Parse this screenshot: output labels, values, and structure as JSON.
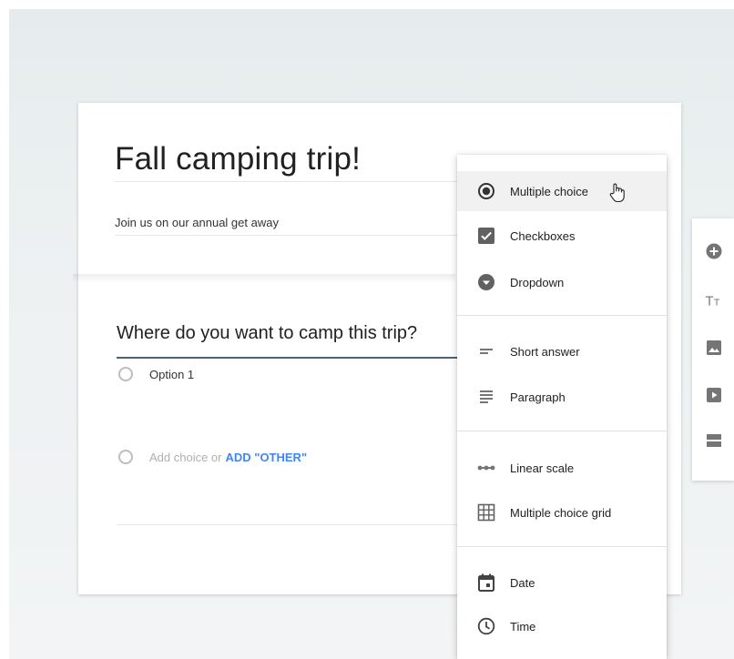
{
  "form": {
    "title": "Fall camping trip!",
    "description": "Join us on our annual get away",
    "question": "Where do you want to camp this trip?",
    "option1": "Option 1",
    "add_choice": "Add choice or",
    "add_other": "ADD \"OTHER\""
  },
  "menu": {
    "items": [
      {
        "label": "Multiple choice",
        "icon": "radio-button-icon"
      },
      {
        "label": "Checkboxes",
        "icon": "checkbox-icon"
      },
      {
        "label": "Dropdown",
        "icon": "dropdown-icon"
      },
      {
        "label": "Short answer",
        "icon": "short-answer-icon"
      },
      {
        "label": "Paragraph",
        "icon": "paragraph-icon"
      },
      {
        "label": "Linear scale",
        "icon": "linear-scale-icon"
      },
      {
        "label": "Multiple choice grid",
        "icon": "grid-icon"
      },
      {
        "label": "Date",
        "icon": "calendar-icon"
      },
      {
        "label": "Time",
        "icon": "clock-icon"
      }
    ],
    "selected": "Multiple choice"
  },
  "toolbar": {
    "tools": [
      "add-question-icon",
      "title-text-icon",
      "image-icon",
      "video-icon",
      "section-icon"
    ]
  },
  "colors": {
    "accent_link": "#4285f4",
    "question_underline": "#4b6478",
    "icon_gray": "#757575"
  }
}
